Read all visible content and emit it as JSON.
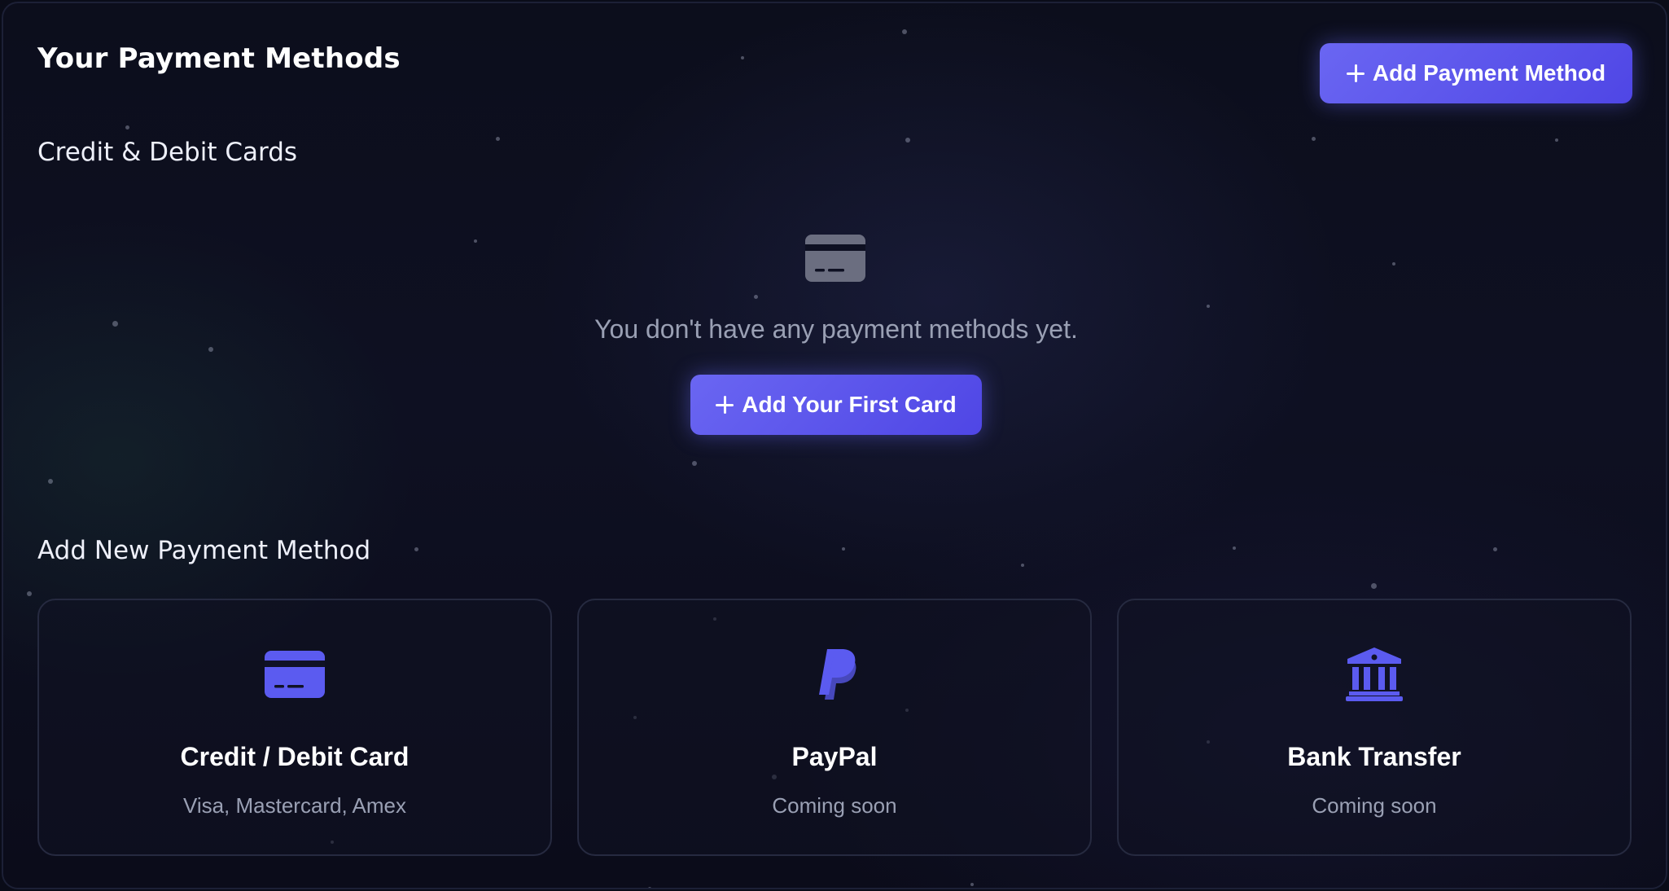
{
  "page": {
    "title": "Your Payment Methods",
    "add_button_label": "Add Payment Method"
  },
  "cards_section": {
    "heading": "Credit & Debit Cards",
    "empty_icon": "credit-card-icon",
    "empty_message": "You don't have any payment methods yet.",
    "add_first_label": "Add Your First Card"
  },
  "new_method_section": {
    "heading": "Add New Payment Method",
    "options": [
      {
        "icon": "credit-card-icon",
        "title": "Credit / Debit Card",
        "subtitle": "Visa, Mastercard, Amex"
      },
      {
        "icon": "paypal-icon",
        "title": "PayPal",
        "subtitle": "Coming soon"
      },
      {
        "icon": "bank-icon",
        "title": "Bank Transfer",
        "subtitle": "Coming soon"
      }
    ]
  },
  "colors": {
    "accent": "#5b5bf0",
    "accent_dark": "#4f46e5",
    "muted_text": "#9aa0b4",
    "empty_icon": "#6b6e80",
    "background": "#0e1022"
  }
}
